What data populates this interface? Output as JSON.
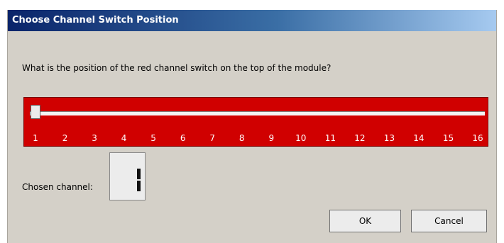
{
  "window": {
    "title": "Choose Channel Switch Position"
  },
  "prompt": {
    "question": "What is the position of the red channel switch on the top of the module?"
  },
  "slider": {
    "min": 1,
    "max": 16,
    "value": 1,
    "panel_color": "#d00000",
    "tick_labels": [
      "1",
      "2",
      "3",
      "4",
      "5",
      "6",
      "7",
      "8",
      "9",
      "10",
      "11",
      "12",
      "13",
      "14",
      "15",
      "16"
    ]
  },
  "chosen": {
    "label": "Chosen channel:",
    "value": "1"
  },
  "buttons": {
    "ok": "OK",
    "cancel": "Cancel"
  }
}
